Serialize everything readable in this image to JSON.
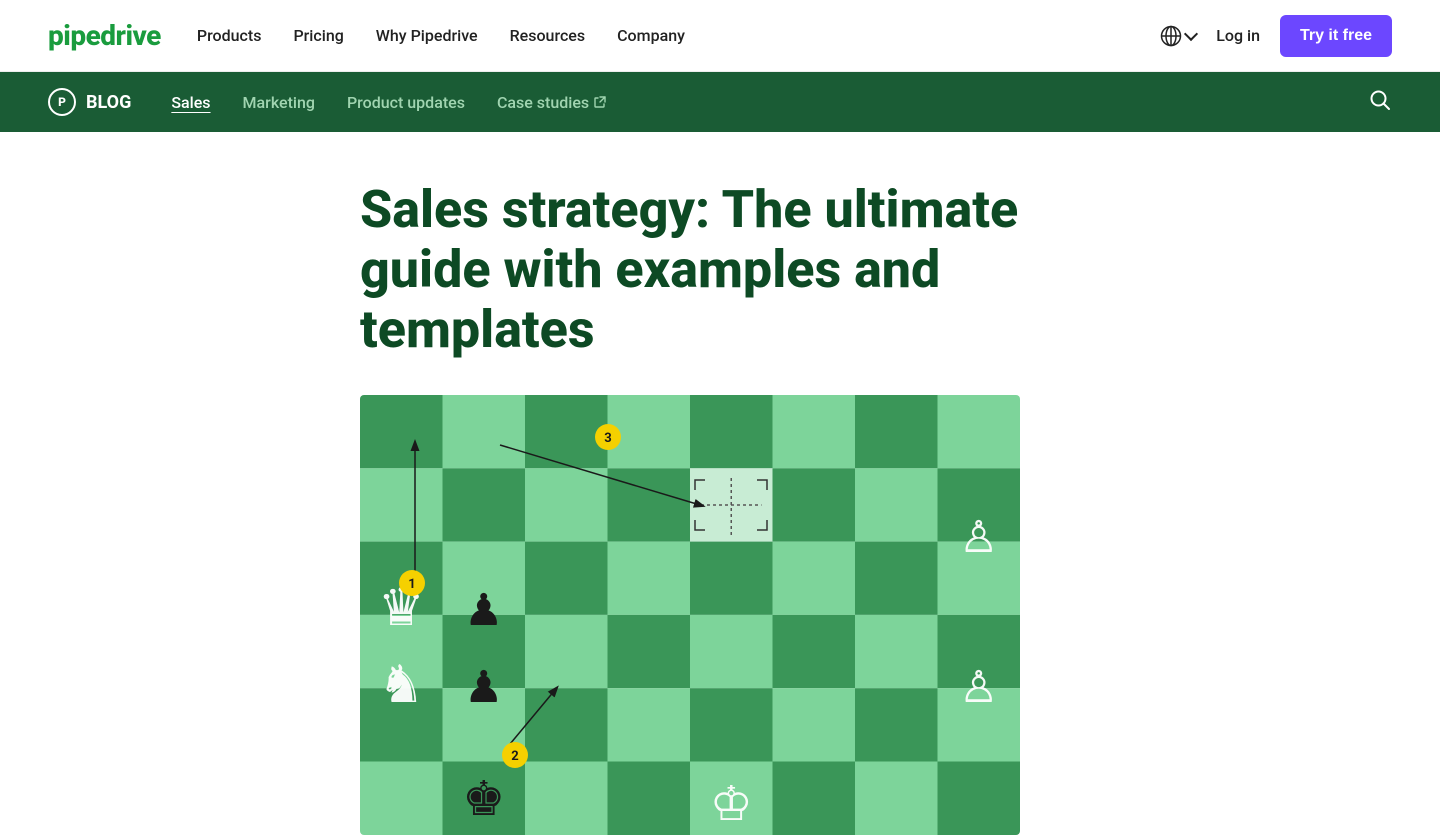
{
  "brand": {
    "name": "pipedrive"
  },
  "topnav": {
    "links": [
      {
        "label": "Products",
        "id": "products"
      },
      {
        "label": "Pricing",
        "id": "pricing"
      },
      {
        "label": "Why Pipedrive",
        "id": "why-pipedrive"
      },
      {
        "label": "Resources",
        "id": "resources"
      },
      {
        "label": "Company",
        "id": "company"
      }
    ],
    "login_label": "Log in",
    "try_free_label": "Try it free",
    "globe_aria": "Language selector"
  },
  "blognav": {
    "brand": "BLOG",
    "brand_icon": "P",
    "links": [
      {
        "label": "Sales",
        "id": "sales",
        "active": true
      },
      {
        "label": "Marketing",
        "id": "marketing"
      },
      {
        "label": "Product updates",
        "id": "product-updates"
      },
      {
        "label": "Case studies",
        "id": "case-studies",
        "external": true
      }
    ],
    "search_aria": "Search"
  },
  "article": {
    "title": "Sales strategy: The ultimate guide with examples and templates"
  },
  "chess": {
    "badges": [
      "1",
      "2",
      "3"
    ]
  }
}
